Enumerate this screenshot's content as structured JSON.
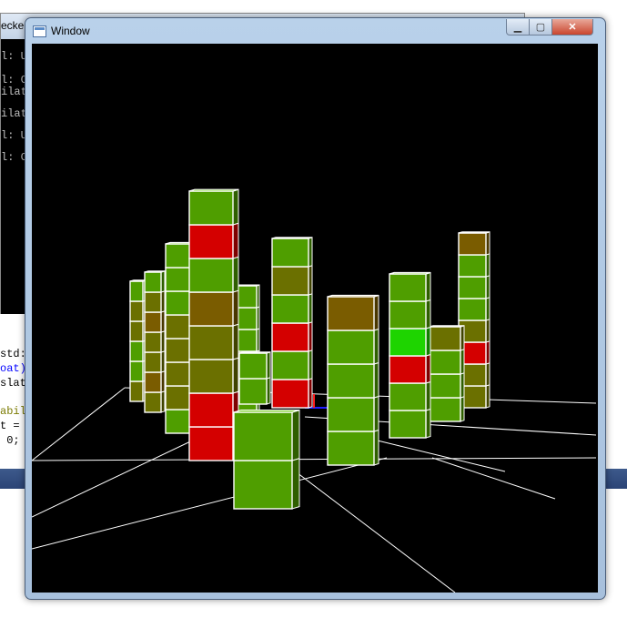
{
  "background_console": {
    "title": "ecker",
    "lines": [
      "l: Ui",
      "l: Cl",
      "ilat",
      "ilat",
      "l: Ui",
      "l: Cl"
    ]
  },
  "background_editor": {
    "lines": [
      "std:",
      "oat)",
      "slat",
      "abil",
      "t =",
      " 0;"
    ]
  },
  "window": {
    "title": "Window",
    "minimize_label": "▁",
    "maximize_label": "▢",
    "close_label": "✕"
  },
  "scene": {
    "background": "#000000",
    "grid_color": "#ffffff",
    "cube_edge_color": "#ffffff",
    "palette": {
      "green": "#4f9e00",
      "lime": "#1ed400",
      "olive": "#6b7000",
      "brown": "#7a5c00",
      "red": "#d40000",
      "yellowgreen": "#3fb000"
    },
    "towers": [
      {
        "name": "tower-back-left-1",
        "colors": [
          "olive",
          "green",
          "green",
          "olive",
          "olive",
          "green"
        ]
      },
      {
        "name": "tower-back-left-2",
        "colors": [
          "olive",
          "brown",
          "olive",
          "olive",
          "brown",
          "olive",
          "green"
        ]
      },
      {
        "name": "tower-left",
        "colors": [
          "green",
          "olive",
          "olive",
          "olive",
          "olive",
          "green",
          "green",
          "green"
        ]
      },
      {
        "name": "tower-tall-left",
        "colors": [
          "red",
          "red",
          "olive",
          "olive",
          "brown",
          "green",
          "red",
          "green"
        ]
      },
      {
        "name": "tower-mid-left",
        "colors": [
          "green",
          "green",
          "olive",
          "green",
          "green",
          "green"
        ]
      },
      {
        "name": "tower-center-tall",
        "colors": [
          "red",
          "green",
          "red",
          "green",
          "olive",
          "green"
        ]
      },
      {
        "name": "tower-center-small",
        "colors": [
          "green",
          "red",
          "green",
          "red"
        ]
      },
      {
        "name": "tower-center-front",
        "colors": [
          "green",
          "green",
          "green",
          "green",
          "brown"
        ]
      },
      {
        "name": "tower-center-right",
        "colors": [
          "green",
          "green",
          "red",
          "lime",
          "green",
          "green"
        ]
      },
      {
        "name": "tower-right-mid",
        "colors": [
          "green",
          "green",
          "green",
          "olive"
        ]
      },
      {
        "name": "tower-far-right",
        "colors": [
          "olive",
          "olive",
          "red",
          "olive",
          "green",
          "green",
          "green",
          "brown"
        ]
      },
      {
        "name": "tower-front",
        "colors": [
          "green",
          "green"
        ]
      },
      {
        "name": "tower-small-mid",
        "colors": [
          "green",
          "green"
        ]
      }
    ]
  }
}
